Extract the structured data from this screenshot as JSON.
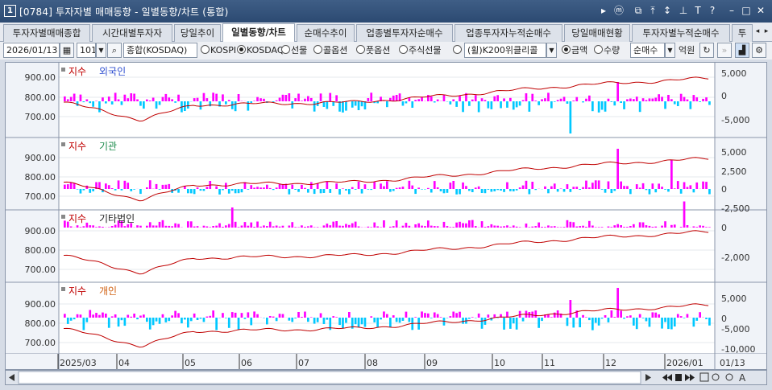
{
  "window": {
    "number": "1",
    "title": "[0784] 투자자별 매매동향 - 일별동향/차트 (통합)",
    "buttons": [
      "▸",
      "ⓜ",
      "⧉",
      "⤒",
      "↕",
      "T",
      "?",
      "–",
      "□",
      "✕"
    ]
  },
  "tabs": [
    {
      "label": "투자자별매매종합",
      "active": false
    },
    {
      "label": "시간대별투자자",
      "active": false
    },
    {
      "label": "당일추이",
      "active": false
    },
    {
      "label": "일별동향/차트",
      "active": true
    },
    {
      "label": "순매수추이",
      "active": false
    },
    {
      "label": "업종별투자자순매수",
      "active": false
    },
    {
      "label": "업종투자자누적순매수",
      "active": false
    },
    {
      "label": "당일매매현황",
      "active": false
    },
    {
      "label": "투자자별누적순매수",
      "active": false
    },
    {
      "label": "투",
      "active": false
    }
  ],
  "toolbar": {
    "date": "2026/01/13",
    "code": "101",
    "market": "종합(KOSDAQ)",
    "radios": [
      {
        "label": "KOSPI",
        "checked": false
      },
      {
        "label": "KOSDAQ",
        "checked": true
      },
      {
        "label": "선물",
        "checked": false
      },
      {
        "label": "콜옵션",
        "checked": false
      },
      {
        "label": "풋옵션",
        "checked": false
      },
      {
        "label": "주식선물",
        "checked": false
      },
      {
        "label": "",
        "checked": false
      }
    ],
    "futures_select": "(휠)K200위클리콜",
    "unit_radios": [
      {
        "label": "금액",
        "checked": true
      },
      {
        "label": "수량",
        "checked": false
      }
    ],
    "type_select": "순매수",
    "unit_label": "억원"
  },
  "legend_index": "지수",
  "colors": {
    "index_line": "#c00000",
    "positive": "#ff00ff",
    "negative": "#00c8ff",
    "foreign": "#3050d0",
    "institution": "#1a8a4a",
    "other": "#222222",
    "individual": "#d06010",
    "axis_bg": "#f0f3f8"
  },
  "panels": [
    {
      "name": "외국인",
      "left_ticks": [
        "900.00",
        "800.00",
        "700.00"
      ],
      "right_ticks": [
        "5,000",
        "0",
        "-5,000"
      ]
    },
    {
      "name": "기관",
      "left_ticks": [
        "900.00",
        "800.00",
        "700.00"
      ],
      "right_ticks": [
        "5,000",
        "2,500",
        "0",
        "-2,500"
      ]
    },
    {
      "name": "기타법인",
      "left_ticks": [
        "900.00",
        "800.00",
        "700.00"
      ],
      "right_ticks": [
        "0",
        "-2,000"
      ]
    },
    {
      "name": "개인",
      "left_ticks": [
        "900.00",
        "800.00",
        "700.00"
      ],
      "right_ticks": [
        "5,000",
        "0",
        "-5,000",
        "-10,000"
      ]
    }
  ],
  "x_axis": [
    "2025/03",
    "04",
    "05",
    "06",
    "07",
    "08",
    "09",
    "10",
    "11",
    "12",
    "2026/01"
  ],
  "x_axis_right": "01/13"
}
